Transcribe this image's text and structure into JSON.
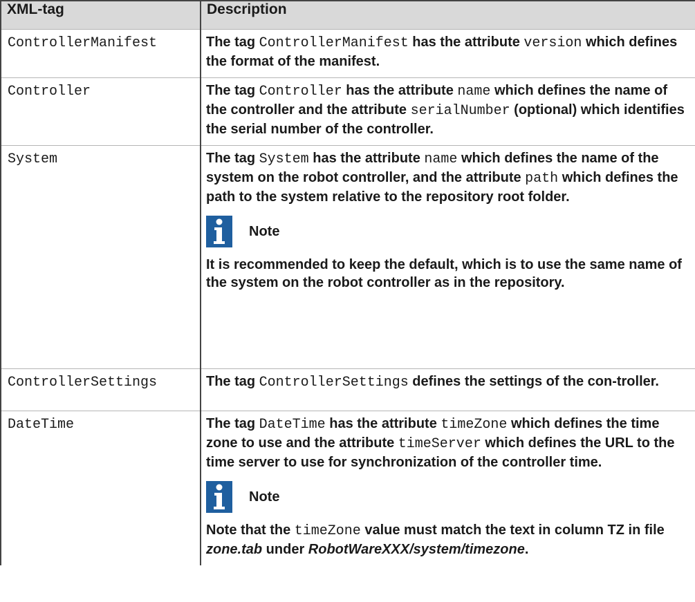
{
  "header": {
    "col_tag": "XML-tag",
    "col_desc": "Description"
  },
  "rows": [
    {
      "tag": "ControllerManifest",
      "desc": {
        "t1": "The tag ",
        "c1": "ControllerManifest",
        "t2": " has the attribute ",
        "c2": "version",
        "t3": " which defines the format of the manifest."
      }
    },
    {
      "tag": "Controller",
      "desc": {
        "t1": "The tag ",
        "c1": "Controller",
        "t2": " has the attribute ",
        "c2": "name",
        "t3": " which defines the name of the controller and the attribute ",
        "c3": "serialNumber",
        "t4": " (optional) which identifies the serial number of the controller."
      }
    },
    {
      "tag": "System",
      "desc": {
        "t1": "The tag ",
        "c1": "System",
        "t2": " has the attribute ",
        "c2": "name",
        "t3": " which defines the name of the system on the robot controller, and the attribute ",
        "c3": "path",
        "t4": " which defines the path to the system relative to the repository root folder."
      },
      "note": {
        "icon": "info-icon",
        "title": "Note",
        "text": "It is recommended to keep the default, which is to use the same name of the system on the robot controller as in the repository."
      }
    },
    {
      "tag": "ControllerSettings",
      "desc": {
        "t1": "The tag ",
        "c1": "ControllerSettings",
        "t2": " defines the settings of the con-troller."
      }
    },
    {
      "tag": "DateTime",
      "desc": {
        "t1": "The tag ",
        "c1": "DateTime",
        "t2": " has the attribute ",
        "c2": "timeZone",
        "t3": " which defines the time zone to use and the attribute ",
        "c3": "timeServer",
        "t4": " which defines the URL to the time server to use for synchronization of the controller time."
      },
      "note": {
        "icon": "info-icon",
        "title": "Note",
        "n1": "Note that the ",
        "nc1": "timeZone",
        "n2": " value must match the text in column TZ in file ",
        "ni1": "zone.tab",
        "n3": " under ",
        "ni2": "RobotWareXXX/system/timezone",
        "n4": "."
      }
    }
  ],
  "colors": {
    "header_bg": "#d9d9d9",
    "icon_blue": "#1f5f9f",
    "border": "#444444"
  }
}
